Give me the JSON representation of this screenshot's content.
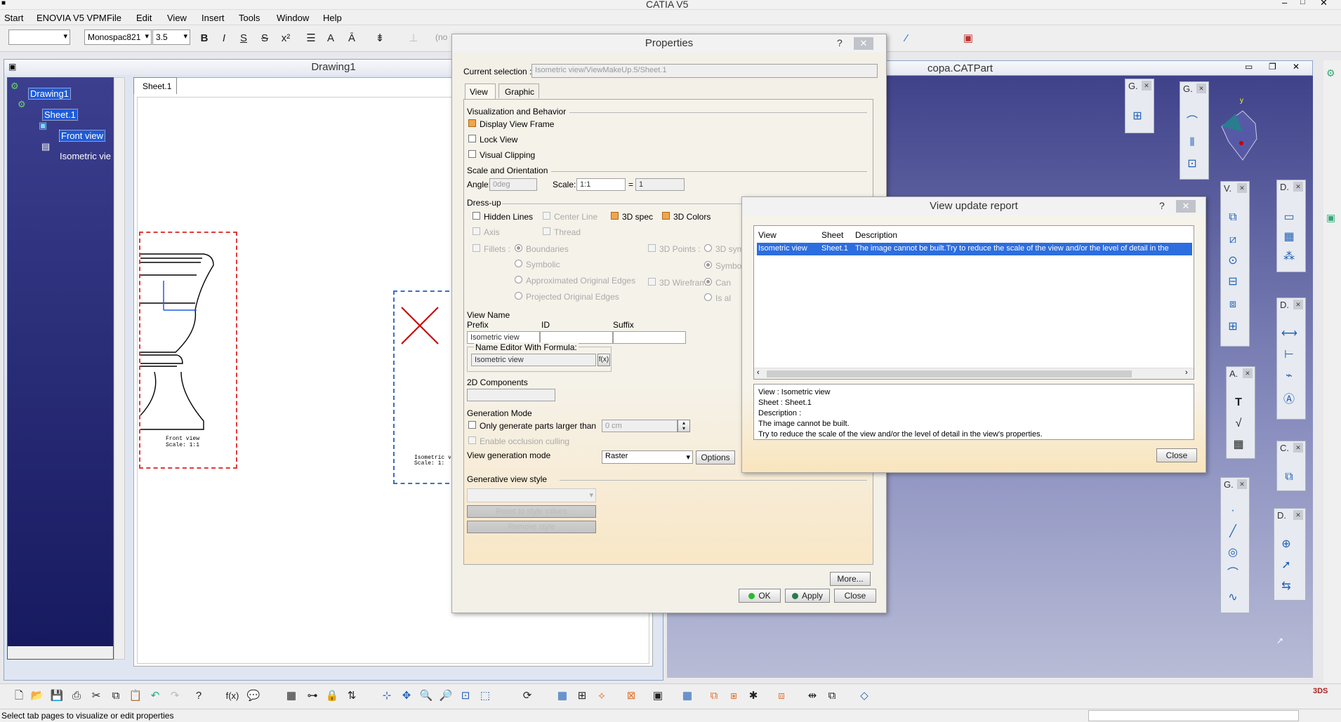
{
  "app": {
    "title": "CATIA V5"
  },
  "menu": [
    "Start",
    "ENOVIA V5 VPM",
    "File",
    "Edit",
    "View",
    "Insert",
    "Tools",
    "Window",
    "Help"
  ],
  "toolbar": {
    "font_name": "Monospac821",
    "font_size": "3.5",
    "partial_field": "(no"
  },
  "drawing_window": {
    "title": "Drawing1",
    "sheet_tab": "Sheet.1"
  },
  "tree": {
    "root": "Drawing1",
    "sheet": "Sheet.1",
    "front": "Front view",
    "iso": "Isometric vie"
  },
  "sheet_labels": {
    "front_caption": "Front view",
    "front_scale": "Scale:  1:1",
    "iso_caption": "Isometric vi",
    "iso_scale": "Scale:  1:"
  },
  "part_window": {
    "title": "copa.CATPart"
  },
  "palettes": [
    "G.",
    "G.",
    "V.",
    "D.",
    "D.",
    "A.",
    "C.",
    "G.",
    "D."
  ],
  "properties": {
    "title": "Properties",
    "current_selection_label": "Current selection :",
    "current_selection": "Isometric view/ViewMakeUp.5/Sheet.1",
    "tabs": [
      "View",
      "Graphic"
    ],
    "vis_section": "Visualization and Behavior",
    "display_view_frame": "Display View Frame",
    "lock_view": "Lock View",
    "visual_clipping": "Visual Clipping",
    "scale_section": "Scale and Orientation",
    "angle_label": "Angle:",
    "angle_value": "0deg",
    "scale_label": "Scale:",
    "scale_value": "1:1",
    "eq": "=",
    "scale_num": "1",
    "dressup_section": "Dress-up",
    "hidden_lines": "Hidden Lines",
    "center_line": "Center Line",
    "spec3d": "3D spec",
    "colors3d": "3D Colors",
    "axis": "Axis",
    "thread": "Thread",
    "fillets": "Fillets :",
    "boundaries": "Boundaries",
    "symbolic": "Symbolic",
    "approx_edges": "Approximated Original Edges",
    "projected_edges": "Projected Original Edges",
    "points3d": "3D Points :",
    "sym3d": "3D sym",
    "symbo": "Symbo",
    "wireframe3d": "3D Wireframe",
    "can": "Can",
    "isa": "Is al",
    "viewname_section": "View Name",
    "prefix_label": "Prefix",
    "id_label": "ID",
    "suffix_label": "Suffix",
    "prefix_value": "Isometric view",
    "name_editor_label": "Name Editor With Formula:",
    "name_editor_value": "Isometric view",
    "components_section": "2D Components",
    "generation_section": "Generation Mode",
    "only_generate": "Only generate parts larger than",
    "only_value": "0 cm",
    "enable_occlusion": "Enable occlusion culling",
    "view_gen_mode_label": "View generation mode",
    "view_gen_mode_value": "Raster",
    "options_btn": "Options",
    "gen_style_section": "Generative view style",
    "reset_style": "Reset to style values",
    "remove_style": "Remove style",
    "more_btn": "More...",
    "ok_btn": "OK",
    "apply_btn": "Apply",
    "close_btn": "Close"
  },
  "report": {
    "title": "View update report",
    "col_view": "View",
    "col_sheet": "Sheet",
    "col_desc": "Description",
    "row_view": "Isometric view",
    "row_sheet": "Sheet.1",
    "row_desc": "The image cannot be built.Try to reduce the scale of the view and/or the level of detail in the",
    "detail": [
      "View : Isometric view",
      "Sheet : Sheet.1",
      "Description :",
      "The image cannot be built.",
      "Try to reduce the scale of the view and/or the level of detail in the view's properties."
    ],
    "close_btn": "Close"
  },
  "status": {
    "text": "Select tab pages to visualize or edit properties"
  },
  "colors": {
    "tree_bg": "#1c1f66",
    "selection": "#1e5ad8",
    "dialog_bg": "#f3f0e8",
    "error_red": "#cc0000"
  }
}
